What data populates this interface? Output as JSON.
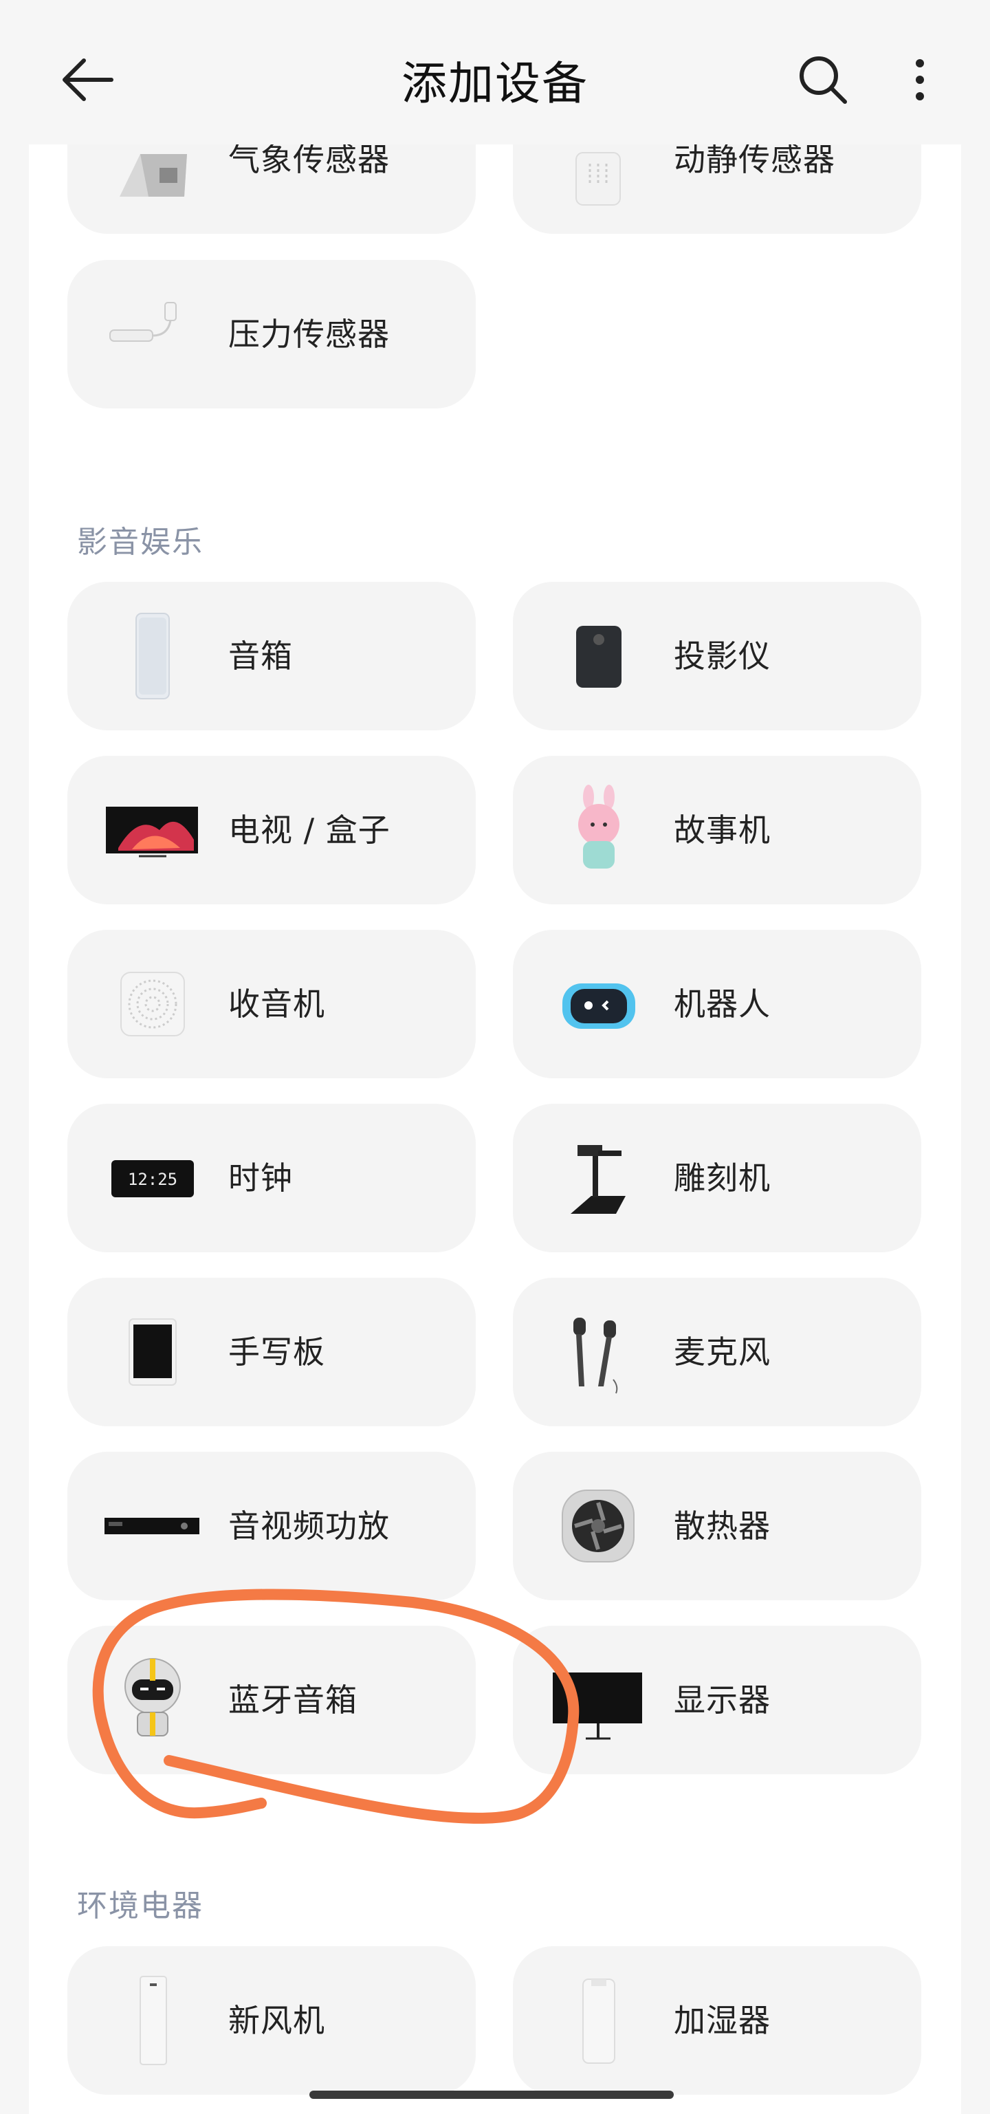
{
  "header": {
    "title": "添加设备",
    "back_icon": "arrow-left-icon",
    "search_icon": "search-icon",
    "more_icon": "more-vertical-icon"
  },
  "sensors": {
    "weather": {
      "label": "气象传感器",
      "icon": "weather-sensor-icon"
    },
    "motion": {
      "label": "动静传感器",
      "icon": "motion-sensor-icon"
    },
    "pressure": {
      "label": "压力传感器",
      "icon": "pressure-sensor-icon"
    }
  },
  "av_entertainment": {
    "title": "影音娱乐",
    "speaker": {
      "label": "音箱",
      "icon": "smart-speaker-icon"
    },
    "projector": {
      "label": "投影仪",
      "icon": "projector-icon"
    },
    "tv_box": {
      "label": "电视 / 盒子",
      "icon": "tv-icon"
    },
    "story_machine": {
      "label": "故事机",
      "icon": "story-machine-icon"
    },
    "radio": {
      "label": "收音机",
      "icon": "radio-icon"
    },
    "robot": {
      "label": "机器人",
      "icon": "robot-icon"
    },
    "clock": {
      "label": "时钟",
      "icon": "clock-icon",
      "display": "12:25"
    },
    "engraver": {
      "label": "雕刻机",
      "icon": "engraver-icon"
    },
    "tablet": {
      "label": "手写板",
      "icon": "tablet-icon"
    },
    "microphone": {
      "label": "麦克风",
      "icon": "microphone-icon"
    },
    "amplifier": {
      "label": "音视频功放",
      "icon": "amplifier-icon"
    },
    "cooler": {
      "label": "散热器",
      "icon": "cooler-icon"
    },
    "bt_speaker": {
      "label": "蓝牙音箱",
      "icon": "bluetooth-speaker-robot-icon"
    },
    "monitor": {
      "label": "显示器",
      "icon": "monitor-icon"
    }
  },
  "environment": {
    "title": "环境电器",
    "fresh_air": {
      "label": "新风机",
      "icon": "fresh-air-icon"
    },
    "humidifier": {
      "label": "加湿器",
      "icon": "humidifier-icon"
    }
  },
  "colors": {
    "page_bg": "#f6f6f6",
    "card_bg": "#f4f4f4",
    "section_title": "#8a93a6",
    "annotation": "#f47a45"
  }
}
